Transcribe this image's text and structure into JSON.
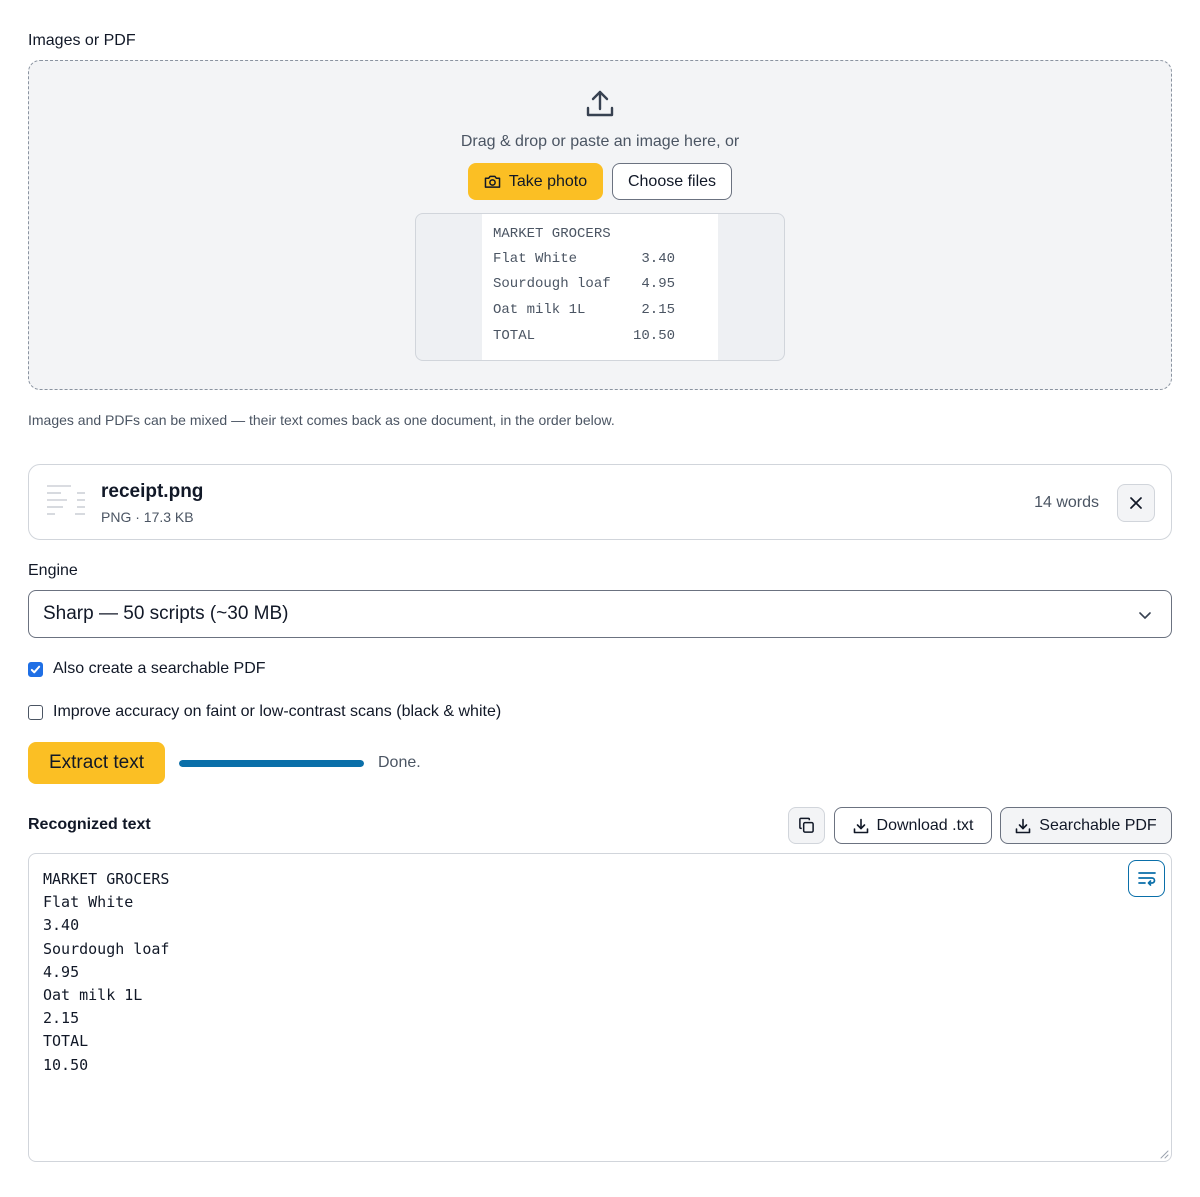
{
  "upload": {
    "label": "Images or PDF",
    "drop_text": "Drag & drop or paste an image here, or",
    "take_photo_label": "Take photo",
    "choose_files_label": "Choose files",
    "hint": "Images and PDFs can be mixed — their text comes back as one document, in the order below.",
    "preview_lines": [
      {
        "name": "MARKET GROCERS",
        "price": ""
      },
      {
        "name": "Flat White",
        "price": "3.40"
      },
      {
        "name": "Sourdough loaf",
        "price": "4.95"
      },
      {
        "name": "Oat milk 1L",
        "price": "2.15"
      },
      {
        "name": "TOTAL",
        "price": "10.50"
      }
    ]
  },
  "file": {
    "name": "receipt.png",
    "meta": "PNG · 17.3 KB",
    "words": "14 words"
  },
  "engine": {
    "label": "Engine",
    "selected": "Sharp — 50 scripts (~30 MB)"
  },
  "options": {
    "searchable_pdf_label": "Also create a searchable PDF",
    "searchable_pdf_checked": true,
    "improve_accuracy_label": "Improve accuracy on faint or low-contrast scans (black & white)",
    "improve_accuracy_checked": false
  },
  "extract": {
    "button_label": "Extract text",
    "progress": 1.0,
    "status": "Done."
  },
  "result": {
    "label": "Recognized text",
    "download_label": "Download .txt",
    "searchable_pdf_label": "Searchable PDF",
    "text": "MARKET GROCERS\nFlat White\n3.40\nSourdough loaf\n4.95\nOat milk 1L\n2.15\nTOTAL\n10.50"
  },
  "colors": {
    "accent": "#fbbf24",
    "progress": "#0a6fa9",
    "checkbox": "#1f6fe5"
  }
}
